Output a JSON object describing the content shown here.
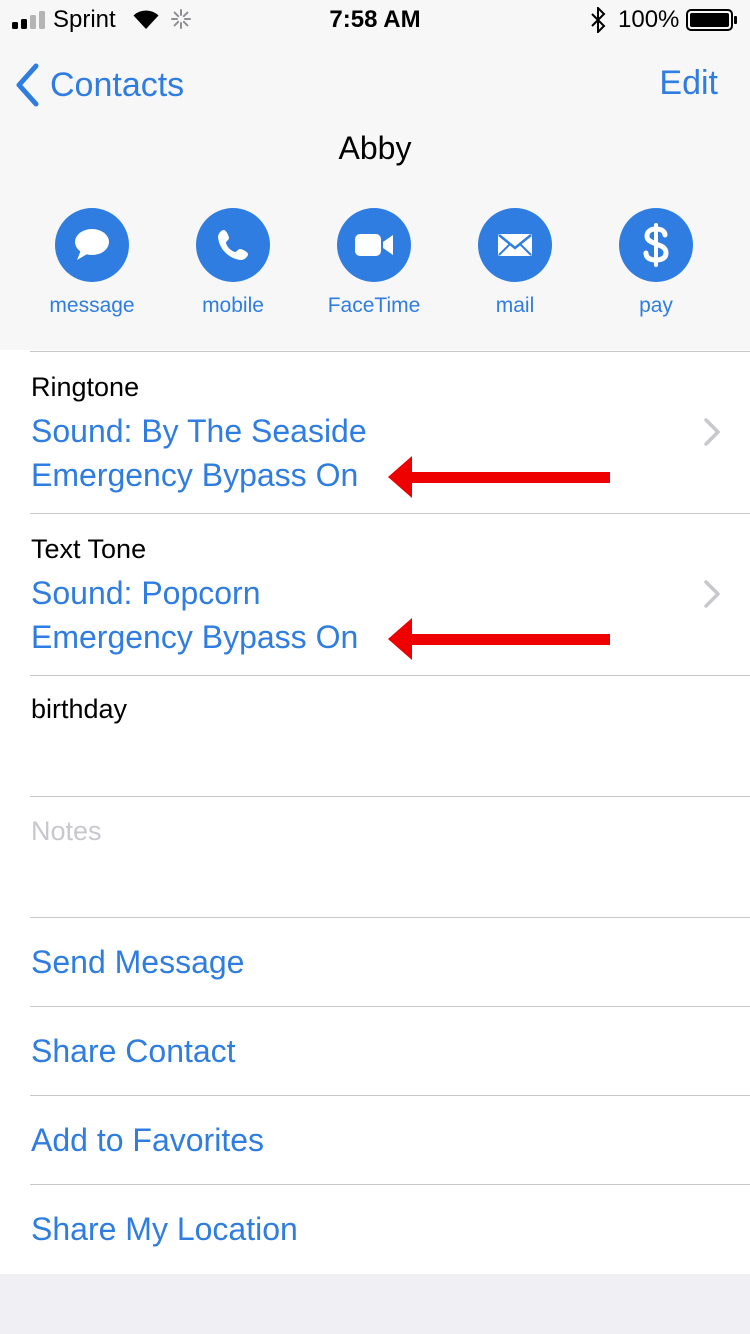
{
  "status_bar": {
    "carrier": "Sprint",
    "time": "7:58 AM",
    "battery": "100%"
  },
  "nav": {
    "back_label": "Contacts",
    "edit_label": "Edit"
  },
  "contact": {
    "name": "Abby"
  },
  "actions": [
    {
      "label": "message",
      "icon": "message-icon"
    },
    {
      "label": "mobile",
      "icon": "phone-icon"
    },
    {
      "label": "FaceTime",
      "icon": "video-icon"
    },
    {
      "label": "mail",
      "icon": "mail-icon"
    },
    {
      "label": "pay",
      "icon": "dollar-icon"
    }
  ],
  "ringtone": {
    "title": "Ringtone",
    "sound": "Sound: By The Seaside",
    "bypass": "Emergency Bypass On"
  },
  "text_tone": {
    "title": "Text Tone",
    "sound": "Sound: Popcorn",
    "bypass": "Emergency Bypass On"
  },
  "birthday": {
    "title": "birthday"
  },
  "notes": {
    "placeholder": "Notes"
  },
  "links": {
    "send_message": "Send Message",
    "share_contact": "Share Contact",
    "add_favorites": "Add to Favorites",
    "share_location": "Share My Location"
  },
  "colors": {
    "accent": "#2f7de1",
    "annotation_arrow": "#ee0000",
    "separator": "#c8c7cc",
    "header_bg": "#f7f7f8"
  }
}
